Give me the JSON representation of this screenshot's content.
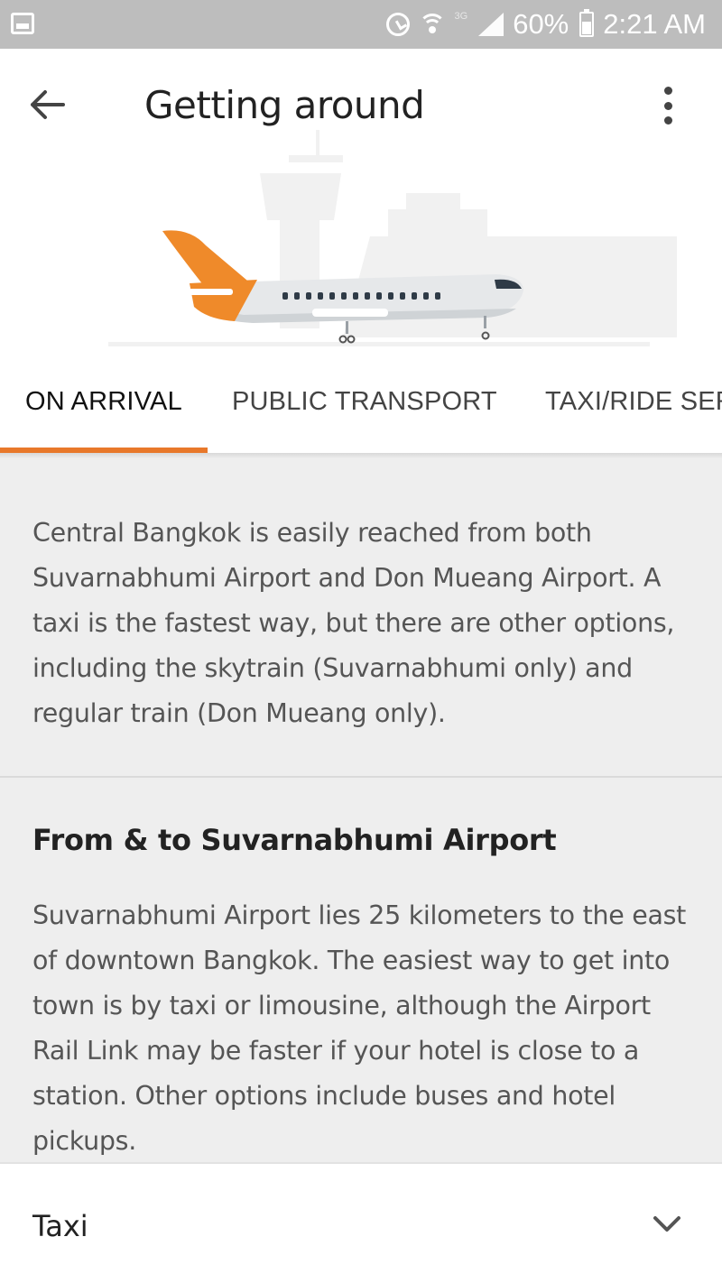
{
  "status_bar": {
    "network": "3G",
    "battery": "60%",
    "time": "2:21 AM"
  },
  "header": {
    "title": "Getting around",
    "back_icon": "arrow-back-icon",
    "menu_icon": "more-vert-icon"
  },
  "tabs": [
    {
      "label": "ON ARRIVAL",
      "active": true
    },
    {
      "label": "PUBLIC TRANSPORT",
      "active": false
    },
    {
      "label": "TAXI/RIDE SERVICES",
      "active": false
    }
  ],
  "content": {
    "intro": "Central Bangkok is easily reached from both Suvarnabhumi Airport and Don Mueang Airport. A taxi is the fastest way, but there are other options, including the skytrain (Suvarnabhumi only) and regular train (Don Mueang only).",
    "section": {
      "title": "From & to Suvarnabhumi Airport",
      "body": "Suvarnabhumi Airport lies 25 kilometers to the east of downtown Bangkok. The easiest way to get into town is by taxi or limousine, although the Airport Rail Link may be faster if your hotel is close to a station. Other options include buses and hotel pickups."
    },
    "accordion": {
      "label": "Taxi",
      "icon": "chevron-down-icon"
    }
  },
  "colors": {
    "accent": "#e8782a",
    "content_bg": "#eeeeee",
    "status_bar": "#bdbdbd"
  }
}
